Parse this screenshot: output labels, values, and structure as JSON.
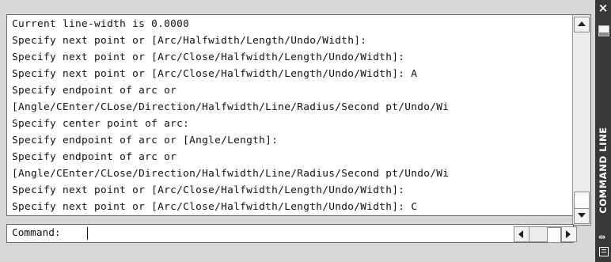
{
  "window": {
    "title": "COMMAND LINE",
    "close_glyph": "×"
  },
  "history": [
    "Current line-width is 0.0000",
    "Specify next point or [Arc/Halfwidth/Length/Undo/Width]:",
    "Specify next point or [Arc/Close/Halfwidth/Length/Undo/Width]:",
    "Specify next point or [Arc/Close/Halfwidth/Length/Undo/Width]: A",
    "Specify endpoint of arc or",
    "[Angle/CEnter/CLose/Direction/Halfwidth/Line/Radius/Second pt/Undo/Wi",
    "Specify center point of arc:",
    "Specify endpoint of arc or [Angle/Length]:",
    "Specify endpoint of arc or",
    "[Angle/CEnter/CLose/Direction/Halfwidth/Line/Radius/Second pt/Undo/Wi",
    "Specify next point or [Arc/Close/Halfwidth/Length/Undo/Width]:",
    "Specify next point or [Arc/Close/Halfwidth/Length/Undo/Width]: C"
  ],
  "command": {
    "prompt": "Command:",
    "value": ""
  },
  "icons": {
    "close": "close-icon",
    "properties": "properties-icon",
    "resize": "resize-icon",
    "list": "list-icon"
  }
}
